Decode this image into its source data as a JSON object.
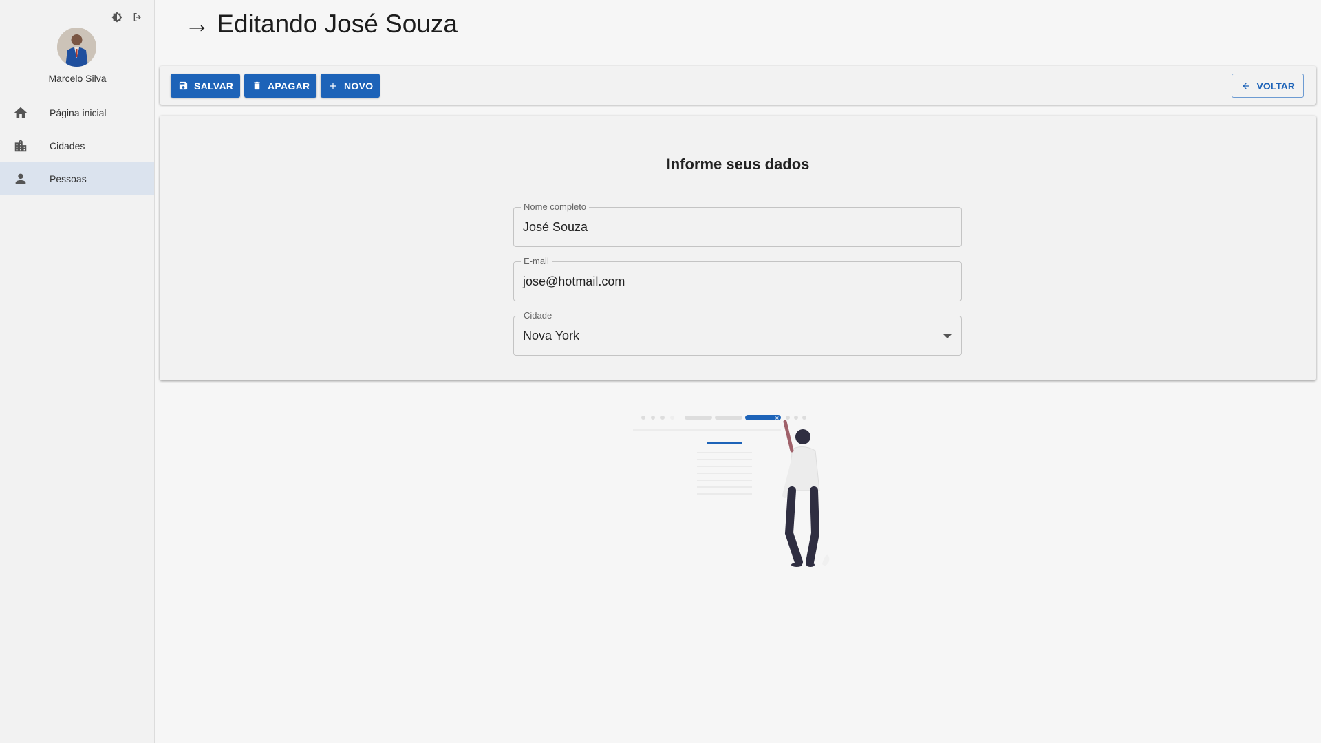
{
  "app": {
    "theme_icon": "brightness-icon",
    "logout_icon": "logout-icon"
  },
  "user": {
    "name": "Marcelo Silva"
  },
  "sidebar": {
    "items": [
      {
        "label": "Página inicial",
        "icon": "home-icon",
        "active": false
      },
      {
        "label": "Cidades",
        "icon": "city-icon",
        "active": false
      },
      {
        "label": "Pessoas",
        "icon": "person-icon",
        "active": true
      }
    ]
  },
  "header": {
    "title": "→ Editando José Souza"
  },
  "toolbar": {
    "save_label": "SALVAR",
    "delete_label": "APAGAR",
    "new_label": "NOVO",
    "back_label": "VOLTAR"
  },
  "form": {
    "title": "Informe seus dados",
    "fields": [
      {
        "label": "Nome completo",
        "value": "José Souza"
      },
      {
        "label": "E-mail",
        "value": "jose@hotmail.com"
      },
      {
        "label": "Cidade",
        "value": "Nova York"
      }
    ]
  },
  "colors": {
    "primary": "#1d63b8",
    "sidebar_bg": "#f2f2f2",
    "active_item": "#dbe3ee"
  }
}
